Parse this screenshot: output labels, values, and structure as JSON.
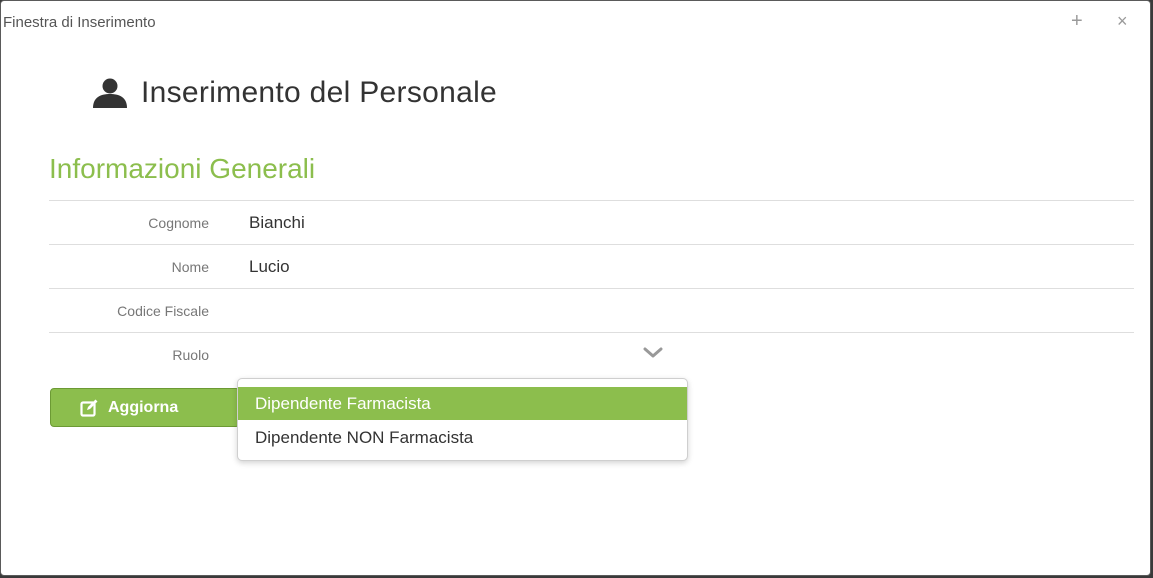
{
  "window": {
    "title": "Finestra di Inserimento",
    "maximize_glyph": "+",
    "close_glyph": "×"
  },
  "page": {
    "icon": "user-icon",
    "title": "Inserimento del Personale"
  },
  "section": {
    "title": "Informazioni Generali"
  },
  "form": {
    "fields": [
      {
        "label": "Cognome",
        "value": "Bianchi"
      },
      {
        "label": "Nome",
        "value": "Lucio"
      },
      {
        "label": "Codice Fiscale",
        "value": ""
      },
      {
        "label": "Ruolo",
        "value": ""
      }
    ]
  },
  "actions": {
    "update_label": "Aggiorna",
    "update_icon": "edit-icon"
  },
  "role_dropdown": {
    "options": [
      {
        "label": "Dipendente Farmacista",
        "highlighted": true
      },
      {
        "label": "Dipendente NON Farmacista",
        "highlighted": false
      }
    ]
  },
  "colors": {
    "accent": "#8cbe4d",
    "accent_border": "#6c9a34",
    "text": "#333333",
    "label": "#777777"
  }
}
